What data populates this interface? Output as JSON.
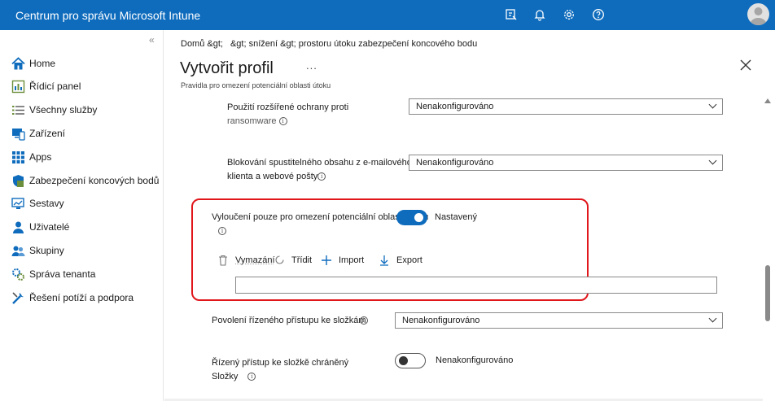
{
  "app": {
    "title": "Centrum pro správu Microsoft Intune"
  },
  "header_icons": [
    "feedback-icon",
    "bell-icon",
    "gear-icon",
    "help-icon"
  ],
  "sidebar": {
    "items": [
      {
        "label": "Home",
        "icon": "home-icon"
      },
      {
        "label": "Řídicí panel",
        "icon": "dashboard-icon"
      },
      {
        "label": "Všechny služby",
        "icon": "list-icon"
      },
      {
        "label": "Zařízení",
        "icon": "devices-icon"
      },
      {
        "label": "Apps",
        "icon": "apps-icon"
      },
      {
        "label": "Zabezpečení koncových bodů",
        "icon": "endpoint-security-icon"
      },
      {
        "label": "Sestavy",
        "icon": "reports-icon"
      },
      {
        "label": "Uživatelé",
        "icon": "user-icon"
      },
      {
        "label": "Skupiny",
        "icon": "groups-icon"
      },
      {
        "label": "Správa tenanta",
        "icon": "tenant-icon"
      },
      {
        "label": "Řešení potíží a podpora",
        "icon": "troubleshoot-icon"
      }
    ]
  },
  "breadcrumb": {
    "home": "Domů &gt;",
    "rest": "&gt; snížení &gt; prostoru útoku zabezpečení koncového bodu"
  },
  "page": {
    "title": "Vytvořit profil",
    "more": "...",
    "subtitle": "Pravidla pro omezení potenciální oblasti útoku"
  },
  "settings": {
    "ransomware": {
      "label_line1": "Použití rozšířené ochrany proti",
      "label_line2": "ransomware",
      "value": "Nenakonfigurováno"
    },
    "email": {
      "label_line1": "Blokování spustitelného obsahu z e-mailového",
      "label_line2": "klienta a webové pošty",
      "value": "Nenakonfigurováno"
    },
    "exclusion": {
      "label": "Vyloučení pouze pro omezení potenciální oblasti útoku",
      "state": "Nastavený",
      "toolbar": {
        "clear": "Vymazání",
        "sort": "Třídit",
        "import": "Import",
        "export": "Export"
      },
      "input_value": ""
    },
    "folder_access": {
      "label": "Povolení řízeného přístupu ke složkám",
      "value": "Nenakonfigurováno"
    },
    "protected_folders": {
      "label_line1": "Řízený přístup ke složkě chráněný",
      "label_line2": "Složky",
      "state": "Nenakonfigurováno"
    }
  },
  "colors": {
    "brand": "#0f6cbd",
    "highlight": "#e0161b"
  }
}
